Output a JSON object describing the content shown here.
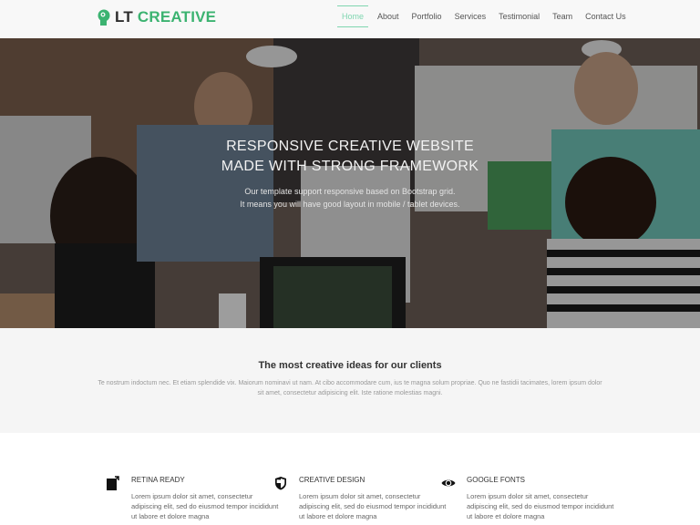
{
  "header": {
    "logo_part1": "LT",
    "logo_part2": "CREATIVE",
    "brand_color": "#3cb371",
    "nav": [
      {
        "label": "Home",
        "active": true
      },
      {
        "label": "About",
        "active": false
      },
      {
        "label": "Portfolio",
        "active": false
      },
      {
        "label": "Services",
        "active": false
      },
      {
        "label": "Testimonial",
        "active": false
      },
      {
        "label": "Team",
        "active": false
      },
      {
        "label": "Contact Us",
        "active": false
      }
    ]
  },
  "hero": {
    "title_line1": "RESPONSIVE CREATIVE WEBSITE",
    "title_line2": "MADE WITH STRONG FRAMEWORK",
    "sub_line1": "Our template support responsive based on Bootstrap grid.",
    "sub_line2": "It means you will have good layout in mobile / tablet devices."
  },
  "intro": {
    "title": "The most creative ideas for our clients",
    "text": "Te nostrum indoctum nec. Et etiam splendide vix. Maiorum nominavi ut nam. At cibo accommodare cum, ius te magna solum propriae. Quo ne fastidii tacimates, lorem ipsum dolor sit amet, consectetur adipisicing elit. Iste ratione molestias magni."
  },
  "features": [
    {
      "icon": "retina-icon",
      "title": "RETINA READY",
      "text": "Lorem ipsum dolor sit amet, consectetur adipiscing elit, sed do eiusmod tempor incididunt ut labore et dolore magna"
    },
    {
      "icon": "shield-icon",
      "title": "CREATIVE DESIGN",
      "text": "Lorem ipsum dolor sit amet, consectetur adipiscing elit, sed do eiusmod tempor incididunt ut labore et dolore magna"
    },
    {
      "icon": "eye-icon",
      "title": "GOOGLE FONTS",
      "text": "Lorem ipsum dolor sit amet, consectetur adipiscing elit, sed do eiusmod tempor incididunt ut labore et dolore magna"
    }
  ]
}
